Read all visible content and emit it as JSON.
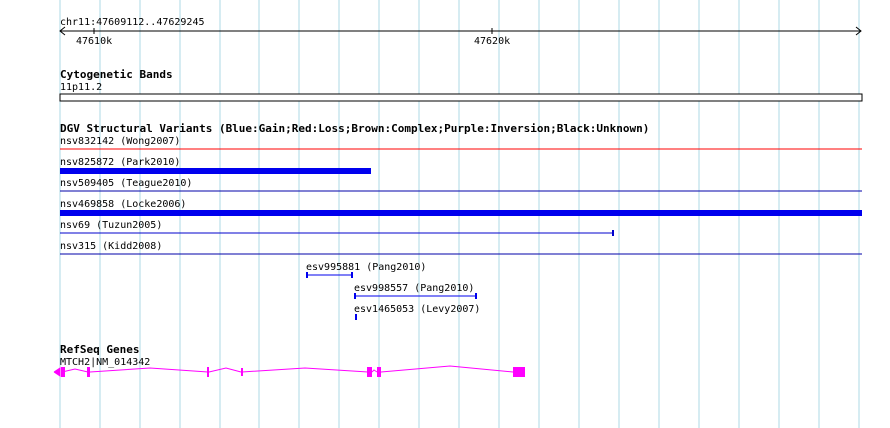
{
  "ruler": {
    "region": "chr11:47609112..47629245",
    "ticks": [
      "47610k",
      "47620k"
    ]
  },
  "cytobands": {
    "title": "Cytogenetic Bands",
    "band": "11p11.2"
  },
  "dgv": {
    "title": "DGV Structural Variants (Blue:Gain;Red:Loss;Brown:Complex;Purple:Inversion;Black:Unknown)",
    "variants": [
      {
        "label": "nsv832142 (Wong2007)",
        "color": "#ff0000"
      },
      {
        "label": "nsv825872 (Park2010)",
        "color": "#0000ee"
      },
      {
        "label": "nsv509405 (Teague2010)",
        "color": "#0000aa"
      },
      {
        "label": "nsv469858 (Locke2006)",
        "color": "#0000ee"
      },
      {
        "label": "nsv69 (Tuzun2005)",
        "color": "#0000cc"
      },
      {
        "label": "nsv315 (Kidd2008)",
        "color": "#0000aa"
      },
      {
        "label": "esv995881 (Pang2010)",
        "color": "#0000ee"
      },
      {
        "label": "esv998557 (Pang2010)",
        "color": "#0000ee"
      },
      {
        "label": "esv1465053 (Levy2007)",
        "color": "#0000ee"
      }
    ]
  },
  "refseq": {
    "title": "RefSeq Genes",
    "gene": "MTCH2|NM_014342",
    "color": "#ff00ff"
  },
  "colors": {
    "grid": "#add8e6",
    "loss": "#ff0000",
    "gain": "#0000ee"
  }
}
